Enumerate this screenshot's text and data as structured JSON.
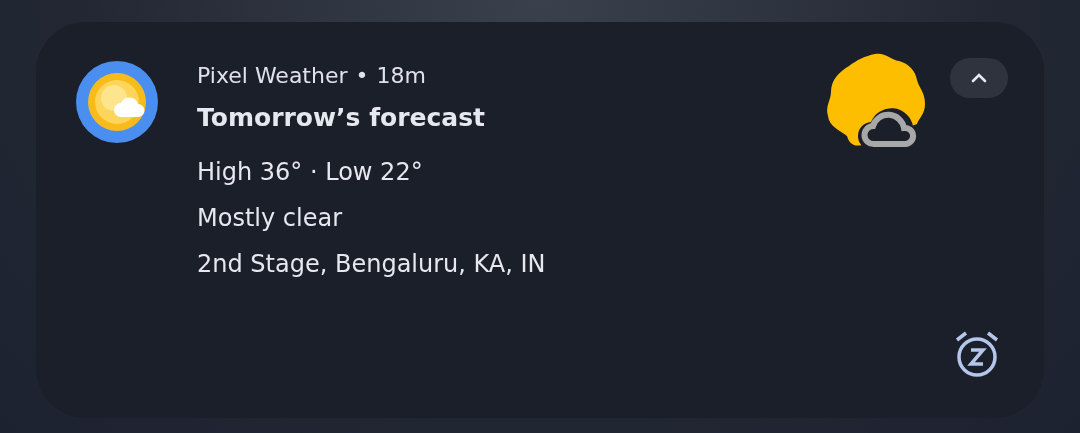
{
  "notification": {
    "app_name": "Pixel Weather",
    "separator": "•",
    "time": "18m",
    "title": "Tomorrow’s forecast",
    "lines": [
      "High 36° · Low 22°",
      "Mostly clear",
      "2nd Stage, Bengaluru, KA, IN"
    ],
    "expanded": true
  }
}
